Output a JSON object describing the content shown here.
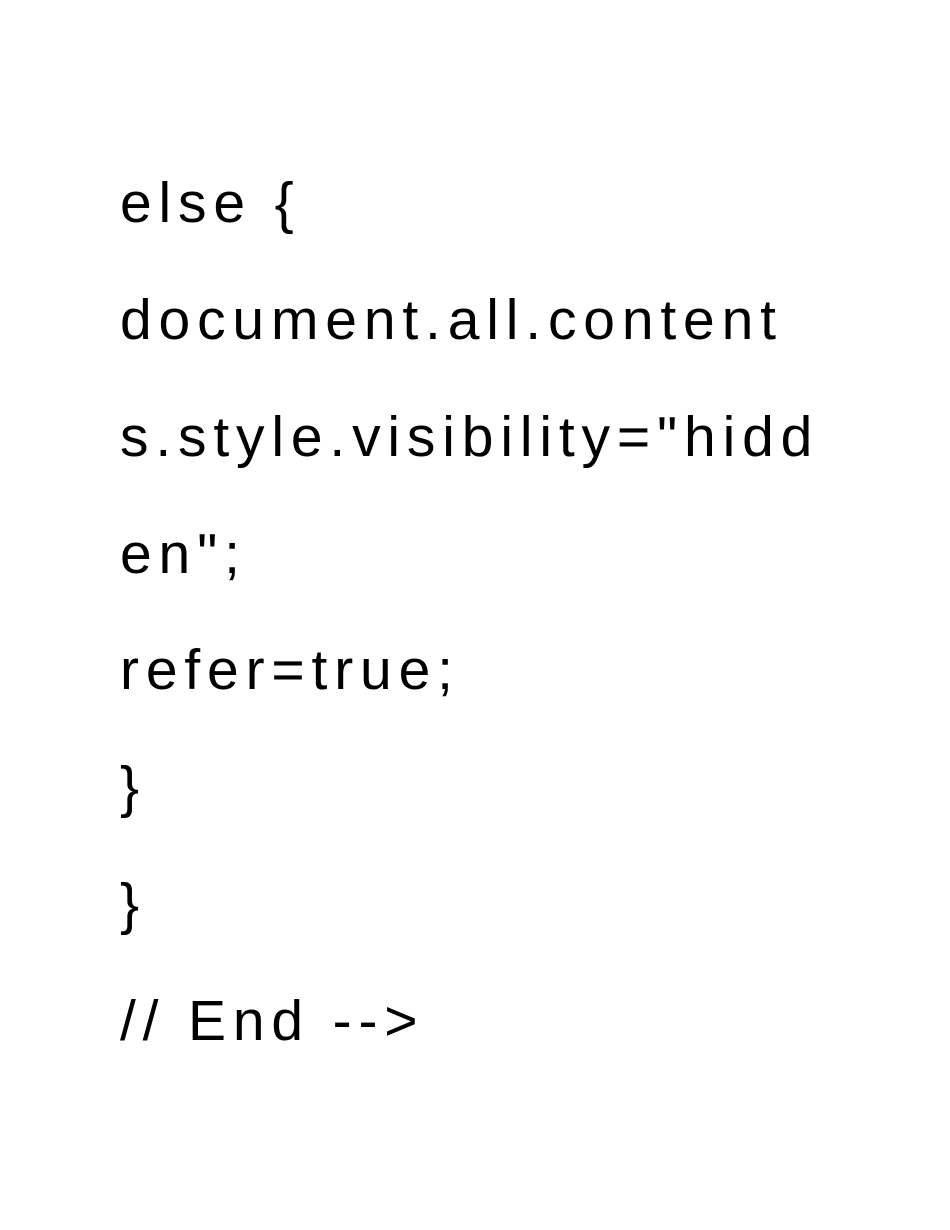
{
  "code": {
    "lines": [
      "else {",
      "document.all.contents.style.visibility=\"hidden\";",
      "refer=true;",
      "}",
      "}",
      "// End -->"
    ]
  }
}
